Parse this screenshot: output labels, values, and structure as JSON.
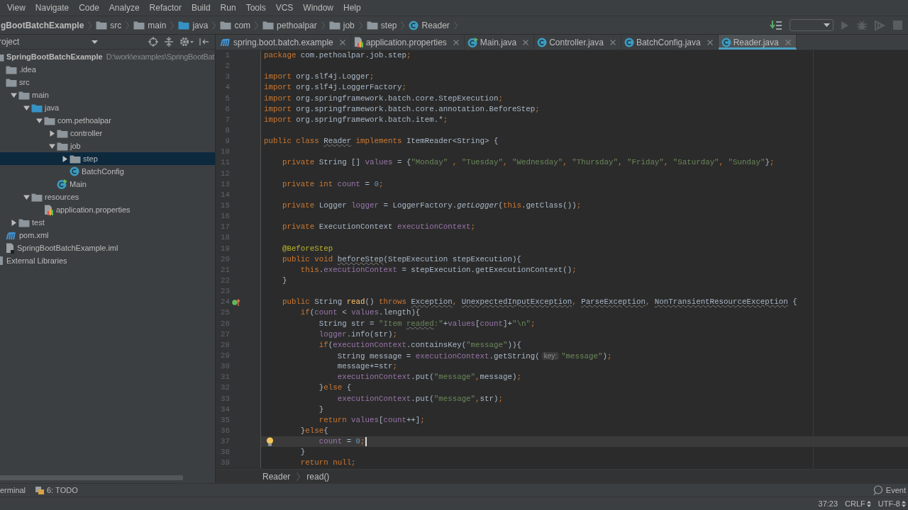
{
  "menu_bar": [
    "View",
    "Navigate",
    "Code",
    "Analyze",
    "Refactor",
    "Build",
    "Run",
    "Tools",
    "VCS",
    "Window",
    "Help"
  ],
  "nav_bar": {
    "crumbs": [
      {
        "label": "gBootBatchExample",
        "kind": "project"
      },
      {
        "label": "src",
        "kind": "folder"
      },
      {
        "label": "main",
        "kind": "folder"
      },
      {
        "label": "java",
        "kind": "source-folder"
      },
      {
        "label": "com",
        "kind": "package"
      },
      {
        "label": "pethoalpar",
        "kind": "package"
      },
      {
        "label": "job",
        "kind": "package"
      },
      {
        "label": "step",
        "kind": "package"
      },
      {
        "label": "Reader",
        "kind": "class"
      }
    ]
  },
  "project_panel": {
    "title": "roject",
    "tree": [
      {
        "label": "SpringBootBatchExample",
        "path": "D:\\work\\examples\\SpringBootBat",
        "kind": "module",
        "selected": false,
        "children": [
          {
            "label": ".idea",
            "kind": "folder",
            "selected": false
          },
          {
            "label": "src",
            "kind": "folder",
            "selected": false,
            "children": [
              {
                "label": "main",
                "kind": "folder",
                "expanded": true,
                "selected": false,
                "children": [
                  {
                    "label": "java",
                    "kind": "source-folder",
                    "expanded": true,
                    "selected": false,
                    "children": [
                      {
                        "label": "com.pethoalpar",
                        "kind": "package",
                        "expanded": true,
                        "selected": false,
                        "children": [
                          {
                            "label": "controller",
                            "kind": "package",
                            "expanded": false,
                            "selected": false
                          },
                          {
                            "label": "job",
                            "kind": "package",
                            "expanded": true,
                            "selected": false,
                            "children": [
                              {
                                "label": "step",
                                "kind": "package",
                                "expanded": false,
                                "selected": true
                              },
                              {
                                "label": "BatchConfig",
                                "kind": "class",
                                "selected": false
                              }
                            ]
                          },
                          {
                            "label": "Main",
                            "kind": "main-class",
                            "selected": false
                          }
                        ]
                      }
                    ]
                  },
                  {
                    "label": "resources",
                    "kind": "resources",
                    "expanded": true,
                    "selected": false,
                    "children": [
                      {
                        "label": "application.properties",
                        "kind": "properties",
                        "selected": false
                      }
                    ]
                  }
                ]
              },
              {
                "label": "test",
                "kind": "folder",
                "expanded": false,
                "selected": false
              }
            ]
          },
          {
            "label": "pom.xml",
            "kind": "maven",
            "selected": false
          },
          {
            "label": "SpringBootBatchExample.iml",
            "kind": "module-file",
            "selected": false
          }
        ]
      },
      {
        "label": "External Libraries",
        "kind": "libraries",
        "selected": false
      }
    ]
  },
  "editor": {
    "tabs": [
      {
        "label": "spring.boot.batch.example",
        "kind": "maven",
        "selected": false
      },
      {
        "label": "application.properties",
        "kind": "properties",
        "selected": false
      },
      {
        "label": "Main.java",
        "kind": "main-class",
        "selected": false
      },
      {
        "label": "Controller.java",
        "kind": "class",
        "selected": false
      },
      {
        "label": "BatchConfig.java",
        "kind": "class",
        "selected": false
      },
      {
        "label": "Reader.java",
        "kind": "class",
        "selected": true
      }
    ],
    "lines": [
      {
        "number": "1",
        "current": false,
        "tokens": [
          {
            "kind": "kw",
            "text": "package"
          },
          {
            "kind": "plain",
            "text": " com.pethoalpar.job.step"
          },
          {
            "kind": "kw",
            "text": ";"
          }
        ]
      },
      {
        "number": "2",
        "current": false
      },
      {
        "number": "3",
        "current": false,
        "tokens": [
          {
            "kind": "kw",
            "text": "import"
          },
          {
            "kind": "plain",
            "text": " org.slf4j.Logger"
          },
          {
            "kind": "kw",
            "text": ";"
          }
        ]
      },
      {
        "number": "4",
        "current": false,
        "tokens": [
          {
            "kind": "kw",
            "text": "import"
          },
          {
            "kind": "plain",
            "text": " org.slf4j.LoggerFactory"
          },
          {
            "kind": "kw",
            "text": ";"
          }
        ]
      },
      {
        "number": "5",
        "current": false,
        "tokens": [
          {
            "kind": "kw",
            "text": "import"
          },
          {
            "kind": "plain",
            "text": " org.springframework.batch.core.StepExecution"
          },
          {
            "kind": "kw",
            "text": ";"
          }
        ]
      },
      {
        "number": "6",
        "current": false,
        "tokens": [
          {
            "kind": "kw",
            "text": "import"
          },
          {
            "kind": "plain",
            "text": " org.springframework.batch.core.annotation.BeforeStep"
          },
          {
            "kind": "kw",
            "text": ";"
          }
        ]
      },
      {
        "number": "7",
        "current": false,
        "tokens": [
          {
            "kind": "kw",
            "text": "import"
          },
          {
            "kind": "plain",
            "text": " org.springframework.batch.item.*"
          },
          {
            "kind": "kw",
            "text": ";"
          }
        ]
      },
      {
        "number": "8",
        "current": false
      },
      {
        "number": "9",
        "current": false,
        "tokens": [
          {
            "kind": "kw",
            "text": "public class "
          },
          {
            "kind": "plain",
            "text": "Reader",
            "wavy": true
          },
          {
            "kind": "kw",
            "text": " implements"
          },
          {
            "kind": "plain",
            "text": " ItemReader<String> {"
          }
        ]
      },
      {
        "number": "10",
        "current": false
      },
      {
        "number": "11",
        "current": false,
        "tokens": [
          {
            "kind": "kw",
            "text": "    private "
          },
          {
            "kind": "plain",
            "text": "String [] "
          },
          {
            "kind": "field",
            "text": "values"
          },
          {
            "kind": "plain",
            "text": " = {"
          },
          {
            "kind": "str",
            "text": "\"Monday\""
          },
          {
            "kind": "kw",
            "text": " , "
          },
          {
            "kind": "str",
            "text": "\"Tuesday\""
          },
          {
            "kind": "kw",
            "text": ", "
          },
          {
            "kind": "str",
            "text": "\"Wednesday\""
          },
          {
            "kind": "kw",
            "text": ", "
          },
          {
            "kind": "str",
            "text": "\"Thursday\""
          },
          {
            "kind": "kw",
            "text": ", "
          },
          {
            "kind": "str",
            "text": "\"Friday\""
          },
          {
            "kind": "kw",
            "text": ", "
          },
          {
            "kind": "str",
            "text": "\"Saturday\""
          },
          {
            "kind": "kw",
            "text": ", "
          },
          {
            "kind": "str",
            "text": "\"Sunday\""
          },
          {
            "kind": "plain",
            "text": "}"
          },
          {
            "kind": "kw",
            "text": ";"
          }
        ]
      },
      {
        "number": "12",
        "current": false
      },
      {
        "number": "13",
        "current": false,
        "tokens": [
          {
            "kind": "kw",
            "text": "    private int "
          },
          {
            "kind": "field",
            "text": "count"
          },
          {
            "kind": "plain",
            "text": " = "
          },
          {
            "kind": "num",
            "text": "0"
          },
          {
            "kind": "kw",
            "text": ";"
          }
        ]
      },
      {
        "number": "14",
        "current": false
      },
      {
        "number": "15",
        "current": false,
        "tokens": [
          {
            "kind": "kw",
            "text": "    private "
          },
          {
            "kind": "plain",
            "text": "Logger "
          },
          {
            "kind": "field",
            "text": "logger"
          },
          {
            "kind": "plain",
            "text": " = LoggerFactory."
          },
          {
            "kind": "static",
            "text": "getLogger"
          },
          {
            "kind": "plain",
            "text": "("
          },
          {
            "kind": "kw",
            "text": "this"
          },
          {
            "kind": "plain",
            "text": ".getClass())"
          },
          {
            "kind": "kw",
            "text": ";"
          }
        ]
      },
      {
        "number": "16",
        "current": false
      },
      {
        "number": "17",
        "current": false,
        "tokens": [
          {
            "kind": "kw",
            "text": "    private "
          },
          {
            "kind": "plain",
            "text": "ExecutionContext "
          },
          {
            "kind": "field",
            "text": "executionContext"
          },
          {
            "kind": "kw",
            "text": ";"
          }
        ]
      },
      {
        "number": "18",
        "current": false
      },
      {
        "number": "19",
        "current": false,
        "tokens": [
          {
            "kind": "ann",
            "text": "    @BeforeStep"
          }
        ]
      },
      {
        "number": "20",
        "current": false,
        "tokens": [
          {
            "kind": "kw",
            "text": "    public void "
          },
          {
            "kind": "plain",
            "text": "beforeStep",
            "wavy": true
          },
          {
            "kind": "plain",
            "text": "(StepExecution stepExecution){"
          }
        ]
      },
      {
        "number": "21",
        "current": false,
        "tokens": [
          {
            "kind": "kw",
            "text": "        this"
          },
          {
            "kind": "plain",
            "text": "."
          },
          {
            "kind": "field",
            "text": "executionContext"
          },
          {
            "kind": "plain",
            "text": " = stepExecution.getExecutionContext()"
          },
          {
            "kind": "kw",
            "text": ";"
          }
        ]
      },
      {
        "number": "22",
        "current": false,
        "tokens": [
          {
            "kind": "plain",
            "text": "    }"
          }
        ]
      },
      {
        "number": "23",
        "current": false
      },
      {
        "number": "24",
        "current": false,
        "gutter": {
          "kind": "override"
        },
        "tokens": [
          {
            "kind": "kw",
            "text": "    public "
          },
          {
            "kind": "plain",
            "text": "String "
          },
          {
            "kind": "decl",
            "text": "read"
          },
          {
            "kind": "plain",
            "text": "() "
          },
          {
            "kind": "kw",
            "text": "throws "
          },
          {
            "kind": "plain",
            "text": "Exception",
            "wavy": true
          },
          {
            "kind": "kw",
            "text": ", "
          },
          {
            "kind": "plain",
            "text": "UnexpectedInputException",
            "wavy": true
          },
          {
            "kind": "kw",
            "text": ", "
          },
          {
            "kind": "plain",
            "text": "ParseException",
            "wavy": true
          },
          {
            "kind": "kw",
            "text": ", "
          },
          {
            "kind": "plain",
            "text": "NonTransientResourceException",
            "wavy": true
          },
          {
            "kind": "plain",
            "text": " {"
          }
        ]
      },
      {
        "number": "25",
        "current": false,
        "tokens": [
          {
            "kind": "kw",
            "text": "        if"
          },
          {
            "kind": "plain",
            "text": "("
          },
          {
            "kind": "field",
            "text": "count"
          },
          {
            "kind": "plain",
            "text": " < "
          },
          {
            "kind": "field",
            "text": "values"
          },
          {
            "kind": "plain",
            "text": ".length){"
          }
        ]
      },
      {
        "number": "26",
        "current": false,
        "tokens": [
          {
            "kind": "plain",
            "text": "            String str = "
          },
          {
            "kind": "str",
            "text": "\"Item "
          },
          {
            "kind": "str",
            "text": "readed",
            "wavy": true
          },
          {
            "kind": "str",
            "text": ":\""
          },
          {
            "kind": "plain",
            "text": "+"
          },
          {
            "kind": "field",
            "text": "values"
          },
          {
            "kind": "plain",
            "text": "["
          },
          {
            "kind": "field",
            "text": "count"
          },
          {
            "kind": "plain",
            "text": "]+"
          },
          {
            "kind": "str",
            "text": "\"\\n\""
          },
          {
            "kind": "kw",
            "text": ";"
          }
        ]
      },
      {
        "number": "27",
        "current": false,
        "tokens": [
          {
            "kind": "field",
            "text": "            logger"
          },
          {
            "kind": "plain",
            "text": ".info(str)"
          },
          {
            "kind": "kw",
            "text": ";"
          }
        ]
      },
      {
        "number": "28",
        "current": false,
        "tokens": [
          {
            "kind": "kw",
            "text": "            if"
          },
          {
            "kind": "plain",
            "text": "("
          },
          {
            "kind": "field",
            "text": "executionContext"
          },
          {
            "kind": "plain",
            "text": ".containsKey("
          },
          {
            "kind": "str",
            "text": "\"message\""
          },
          {
            "kind": "plain",
            "text": ")){"
          }
        ]
      },
      {
        "number": "29",
        "current": false,
        "tokens": [
          {
            "kind": "plain",
            "text": "                String message = "
          },
          {
            "kind": "field",
            "text": "executionContext"
          },
          {
            "kind": "plain",
            "text": ".getString("
          },
          {
            "kind": "hint",
            "text": "key:"
          },
          {
            "kind": "str",
            "text": "\"message\""
          },
          {
            "kind": "plain",
            "text": ")"
          },
          {
            "kind": "kw",
            "text": ";"
          }
        ]
      },
      {
        "number": "30",
        "current": false,
        "tokens": [
          {
            "kind": "plain",
            "text": "                message+=str"
          },
          {
            "kind": "kw",
            "text": ";"
          }
        ]
      },
      {
        "number": "31",
        "current": false,
        "tokens": [
          {
            "kind": "field",
            "text": "                executionContext"
          },
          {
            "kind": "plain",
            "text": ".put("
          },
          {
            "kind": "str",
            "text": "\"message\""
          },
          {
            "kind": "kw",
            "text": ","
          },
          {
            "kind": "plain",
            "text": "message)"
          },
          {
            "kind": "kw",
            "text": ";"
          }
        ]
      },
      {
        "number": "32",
        "current": false,
        "tokens": [
          {
            "kind": "plain",
            "text": "            }"
          },
          {
            "kind": "kw",
            "text": "else"
          },
          {
            "kind": "plain",
            "text": " {"
          }
        ]
      },
      {
        "number": "33",
        "current": false,
        "tokens": [
          {
            "kind": "field",
            "text": "                executionContext"
          },
          {
            "kind": "plain",
            "text": ".put("
          },
          {
            "kind": "str",
            "text": "\"message\""
          },
          {
            "kind": "kw",
            "text": ","
          },
          {
            "kind": "plain",
            "text": "str)"
          },
          {
            "kind": "kw",
            "text": ";"
          }
        ]
      },
      {
        "number": "34",
        "current": false,
        "tokens": [
          {
            "kind": "plain",
            "text": "            }"
          }
        ]
      },
      {
        "number": "35",
        "current": false,
        "tokens": [
          {
            "kind": "kw",
            "text": "            return "
          },
          {
            "kind": "field",
            "text": "values"
          },
          {
            "kind": "plain",
            "text": "["
          },
          {
            "kind": "field",
            "text": "count"
          },
          {
            "kind": "plain",
            "text": "++]"
          },
          {
            "kind": "kw",
            "text": ";"
          }
        ]
      },
      {
        "number": "36",
        "current": false,
        "tokens": [
          {
            "kind": "plain",
            "text": "        }"
          },
          {
            "kind": "kw",
            "text": "else"
          },
          {
            "kind": "plain",
            "text": "{"
          }
        ]
      },
      {
        "number": "37",
        "current": true,
        "gutter": {
          "kind": "bulb"
        },
        "tokens": [
          {
            "kind": "field",
            "text": "            count"
          },
          {
            "kind": "plain",
            "text": " = "
          },
          {
            "kind": "num",
            "text": "0"
          },
          {
            "kind": "kw",
            "text": ";"
          }
        ]
      },
      {
        "number": "38",
        "current": false,
        "tokens": [
          {
            "kind": "plain",
            "text": "        }"
          }
        ]
      },
      {
        "number": "39",
        "current": false,
        "tokens": [
          {
            "kind": "kw",
            "text": "        return null;"
          }
        ]
      }
    ],
    "breadcrumb": [
      "Reader",
      "read()"
    ]
  },
  "tool_windows": [
    {
      "label": "erminal",
      "kind": "terminal"
    },
    {
      "label": "6: TODO",
      "kind": "todo"
    }
  ],
  "event_log": "Event",
  "status_bar": {
    "position": "37:23",
    "line_separator": "CRLF",
    "encoding": "UTF-8"
  }
}
